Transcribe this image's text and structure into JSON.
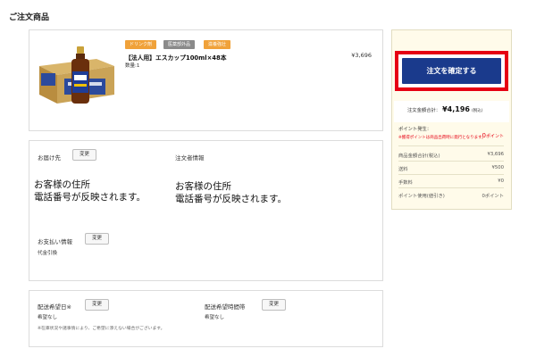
{
  "page": {
    "section_title": "ご注文商品"
  },
  "product": {
    "badges": [
      {
        "label": "ドリンク剤",
        "color": "#f0a23a"
      },
      {
        "label": "医薬部外品",
        "color": "#8a8a8a"
      },
      {
        "label": "滋養強壮",
        "color": "#f0a23a"
      }
    ],
    "name": "【法人用】エスカップ100ml×48本",
    "quantity": "数量:1",
    "price": "¥3,696",
    "image_icon": "drink-bottle-with-case-icon"
  },
  "delivery": {
    "title": "お届け先",
    "change_label": "変更",
    "address_line1": "お客様の住所",
    "address_line2": "電話番号が反映されます。"
  },
  "orderer": {
    "title": "注文者情報",
    "address_line1": "お客様の住所",
    "address_line2": "電話番号が反映されます。"
  },
  "payment": {
    "title": "お支払い情報",
    "change_label": "変更",
    "method": "代金引換"
  },
  "schedule": {
    "date_title": "配送希望日※",
    "date_change_label": "変更",
    "date_value": "希望なし",
    "time_title": "配送希望時間帯",
    "time_change_label": "変更",
    "time_value": "希望なし",
    "note": "※在庫状況や諸事情により、ご希望に添えない場合がございます。"
  },
  "summary": {
    "confirm_label": "注文を確定する",
    "confirm_color": "#1a3a8c",
    "highlight_color": "#e60012",
    "total_label": "注文金額合計：",
    "total_value": "¥4,196",
    "total_suffix": "(税込)",
    "points_label": "ポイント発生：",
    "points_value": "0",
    "points_unit": "ポイント",
    "points_note": "※獲得ポイントは商品出荷時に発行となります。",
    "rows": [
      {
        "label": "商品金額合計(税込)",
        "value": "¥3,696"
      },
      {
        "label": "送料",
        "value": "¥500"
      },
      {
        "label": "手数料",
        "value": "¥0"
      },
      {
        "label": "ポイント使用(値引き)",
        "value": "0ポイント"
      }
    ]
  }
}
